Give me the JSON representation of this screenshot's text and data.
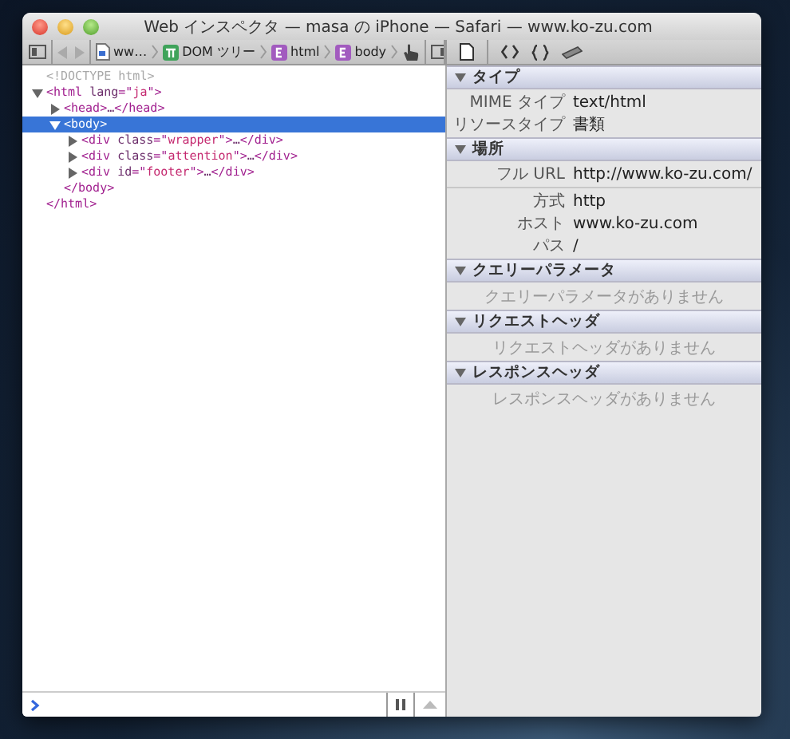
{
  "window": {
    "title": "Web インスペクタ — masa の iPhone — Safari — www.ko-zu.com"
  },
  "breadcrumbs": [
    {
      "kind": "file",
      "label": "ww…"
    },
    {
      "kind": "dom",
      "label": "DOM ツリー"
    },
    {
      "kind": "element",
      "label": "html"
    },
    {
      "kind": "element",
      "label": "body"
    }
  ],
  "dom": [
    {
      "kind": "doctype",
      "selected": false,
      "tokens": [
        {
          "kind": "doctype",
          "text": "<!DOCTYPE html>"
        }
      ]
    },
    {
      "kind": "element",
      "expanded": true,
      "selected": false,
      "tokens": [
        {
          "kind": "tag",
          "text": "<html "
        },
        {
          "kind": "attr",
          "text": "lang"
        },
        {
          "kind": "tag",
          "text": "=\""
        },
        {
          "kind": "value",
          "text": "ja"
        },
        {
          "kind": "tag",
          "text": "\">"
        }
      ],
      "closing": [
        {
          "kind": "tag",
          "text": "</html>"
        }
      ],
      "children": [
        {
          "kind": "element",
          "expanded": false,
          "selected": false,
          "tokens": [
            {
              "kind": "tag",
              "text": "<head>"
            },
            {
              "kind": "attr",
              "text": "…"
            },
            {
              "kind": "tag",
              "text": "</head>"
            }
          ]
        },
        {
          "kind": "element",
          "expanded": true,
          "selected": true,
          "tokens": [
            {
              "kind": "tag",
              "text": "<body>"
            }
          ],
          "closing": [
            {
              "kind": "tag",
              "text": "</body>"
            }
          ],
          "children": [
            {
              "kind": "element",
              "expanded": false,
              "selected": false,
              "tokens": [
                {
                  "kind": "tag",
                  "text": "<div "
                },
                {
                  "kind": "attr",
                  "text": "class"
                },
                {
                  "kind": "tag",
                  "text": "=\""
                },
                {
                  "kind": "value",
                  "text": "wrapper"
                },
                {
                  "kind": "tag",
                  "text": "\">"
                },
                {
                  "kind": "attr",
                  "text": "…"
                },
                {
                  "kind": "tag",
                  "text": "</div>"
                }
              ]
            },
            {
              "kind": "element",
              "expanded": false,
              "selected": false,
              "tokens": [
                {
                  "kind": "tag",
                  "text": "<div "
                },
                {
                  "kind": "attr",
                  "text": "class"
                },
                {
                  "kind": "tag",
                  "text": "=\""
                },
                {
                  "kind": "value",
                  "text": "attention"
                },
                {
                  "kind": "tag",
                  "text": "\">"
                },
                {
                  "kind": "attr",
                  "text": "…"
                },
                {
                  "kind": "tag",
                  "text": "</div>"
                }
              ]
            },
            {
              "kind": "element",
              "expanded": false,
              "selected": false,
              "tokens": [
                {
                  "kind": "tag",
                  "text": "<div "
                },
                {
                  "kind": "attr",
                  "text": "id"
                },
                {
                  "kind": "tag",
                  "text": "=\""
                },
                {
                  "kind": "value",
                  "text": "footer"
                },
                {
                  "kind": "tag",
                  "text": "\">"
                },
                {
                  "kind": "attr",
                  "text": "…"
                },
                {
                  "kind": "tag",
                  "text": "</div>"
                }
              ]
            }
          ]
        }
      ]
    }
  ],
  "sections": [
    {
      "title": "タイプ",
      "expanded": true,
      "groups": [
        [
          {
            "label": "MIME タイプ",
            "value": "text/html"
          },
          {
            "label": "リソースタイプ",
            "value": "書類"
          }
        ]
      ]
    },
    {
      "title": "場所",
      "expanded": true,
      "groups": [
        [
          {
            "label": "フル URL",
            "value": "http://www.ko-zu.com/"
          }
        ],
        [
          {
            "label": "方式",
            "value": "http"
          },
          {
            "label": "ホスト",
            "value": "www.ko-zu.com"
          },
          {
            "label": "パス",
            "value": "/"
          }
        ]
      ]
    },
    {
      "title": "クエリーパラメータ",
      "expanded": true,
      "empty": "クエリーパラメータがありません"
    },
    {
      "title": "リクエストヘッダ",
      "expanded": true,
      "empty": "リクエストヘッダがありません"
    },
    {
      "title": "レスポンスヘッダ",
      "expanded": true,
      "empty": "レスポンスヘッダがありません"
    }
  ]
}
